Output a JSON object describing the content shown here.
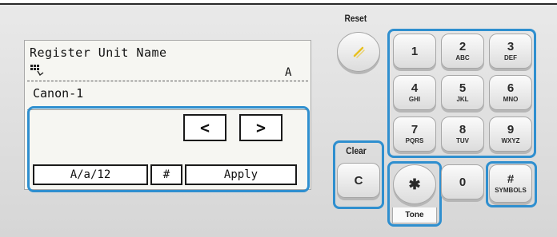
{
  "lcd": {
    "title": "Register Unit Name",
    "input_mode_indicator": "A",
    "value": "Canon-1",
    "left_arrow": "<",
    "right_arrow": ">",
    "softkeys": {
      "mode": "A/a/12",
      "symbol": "#",
      "apply": "Apply"
    }
  },
  "reset": {
    "label": "Reset",
    "icon": "reset-slash-icon"
  },
  "clear": {
    "label": "Clear",
    "key": "C"
  },
  "keypad": [
    {
      "main": "1",
      "sub": ""
    },
    {
      "main": "2",
      "sub": "ABC"
    },
    {
      "main": "3",
      "sub": "DEF"
    },
    {
      "main": "4",
      "sub": "GHI"
    },
    {
      "main": "5",
      "sub": "JKL"
    },
    {
      "main": "6",
      "sub": "MNO"
    },
    {
      "main": "7",
      "sub": "PQRS"
    },
    {
      "main": "8",
      "sub": "TUV"
    },
    {
      "main": "9",
      "sub": "WXYZ"
    }
  ],
  "bottom_row": {
    "star": "✱",
    "tone": "Tone",
    "zero": "0",
    "hash_main": "#",
    "hash_sub": "SYMBOLS"
  },
  "colors": {
    "highlight": "#2f8fcf",
    "reset_mark": "#e8c020"
  }
}
